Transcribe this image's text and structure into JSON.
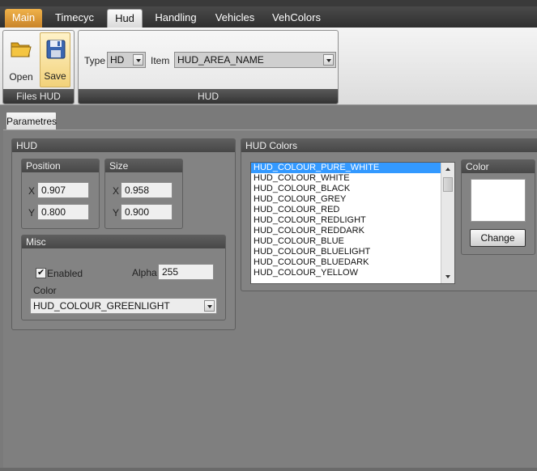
{
  "tabs": [
    {
      "label": "Main",
      "state": "main"
    },
    {
      "label": "Timecyc",
      "state": "normal"
    },
    {
      "label": "Hud",
      "state": "active"
    },
    {
      "label": "Handling",
      "state": "normal"
    },
    {
      "label": "Vehicles",
      "state": "normal"
    },
    {
      "label": "VehColors",
      "state": "normal"
    }
  ],
  "ribbon": {
    "files_group": {
      "caption": "Files HUD",
      "open_label": "Open",
      "save_label": "Save",
      "open_icon": "folder-icon",
      "save_icon": "floppy-disk-icon"
    },
    "hud_group": {
      "caption": "HUD",
      "type_label": "Type",
      "type_value": "HD",
      "item_label": "Item",
      "item_value": "HUD_AREA_NAME"
    }
  },
  "subtab": {
    "label": "Parametres"
  },
  "hud_panel": {
    "title": "HUD",
    "position": {
      "title": "Position",
      "x_label": "X",
      "x_value": "0.907",
      "y_label": "Y",
      "y_value": "0.800"
    },
    "size": {
      "title": "Size",
      "x_label": "X",
      "x_value": "0.958",
      "y_label": "Y",
      "y_value": "0.900"
    },
    "misc": {
      "title": "Misc",
      "enabled_label": "Enabled",
      "enabled": true,
      "alpha_label": "Alpha",
      "alpha_value": "255",
      "color_label": "Color",
      "color_value": "HUD_COLOUR_GREENLIGHT"
    }
  },
  "hud_colors": {
    "title": "HUD Colors",
    "items": [
      "HUD_COLOUR_PURE_WHITE",
      "HUD_COLOUR_WHITE",
      "HUD_COLOUR_BLACK",
      "HUD_COLOUR_GREY",
      "HUD_COLOUR_RED",
      "HUD_COLOUR_REDLIGHT",
      "HUD_COLOUR_REDDARK",
      "HUD_COLOUR_BLUE",
      "HUD_COLOUR_BLUELIGHT",
      "HUD_COLOUR_BLUEDARK",
      "HUD_COLOUR_YELLOW"
    ],
    "selected_index": 0
  },
  "color_box": {
    "title": "Color",
    "swatch_color": "#ffffff",
    "change_label": "Change"
  },
  "colors": {
    "selection": "#3399ff",
    "main_tab": "#e09a38"
  }
}
